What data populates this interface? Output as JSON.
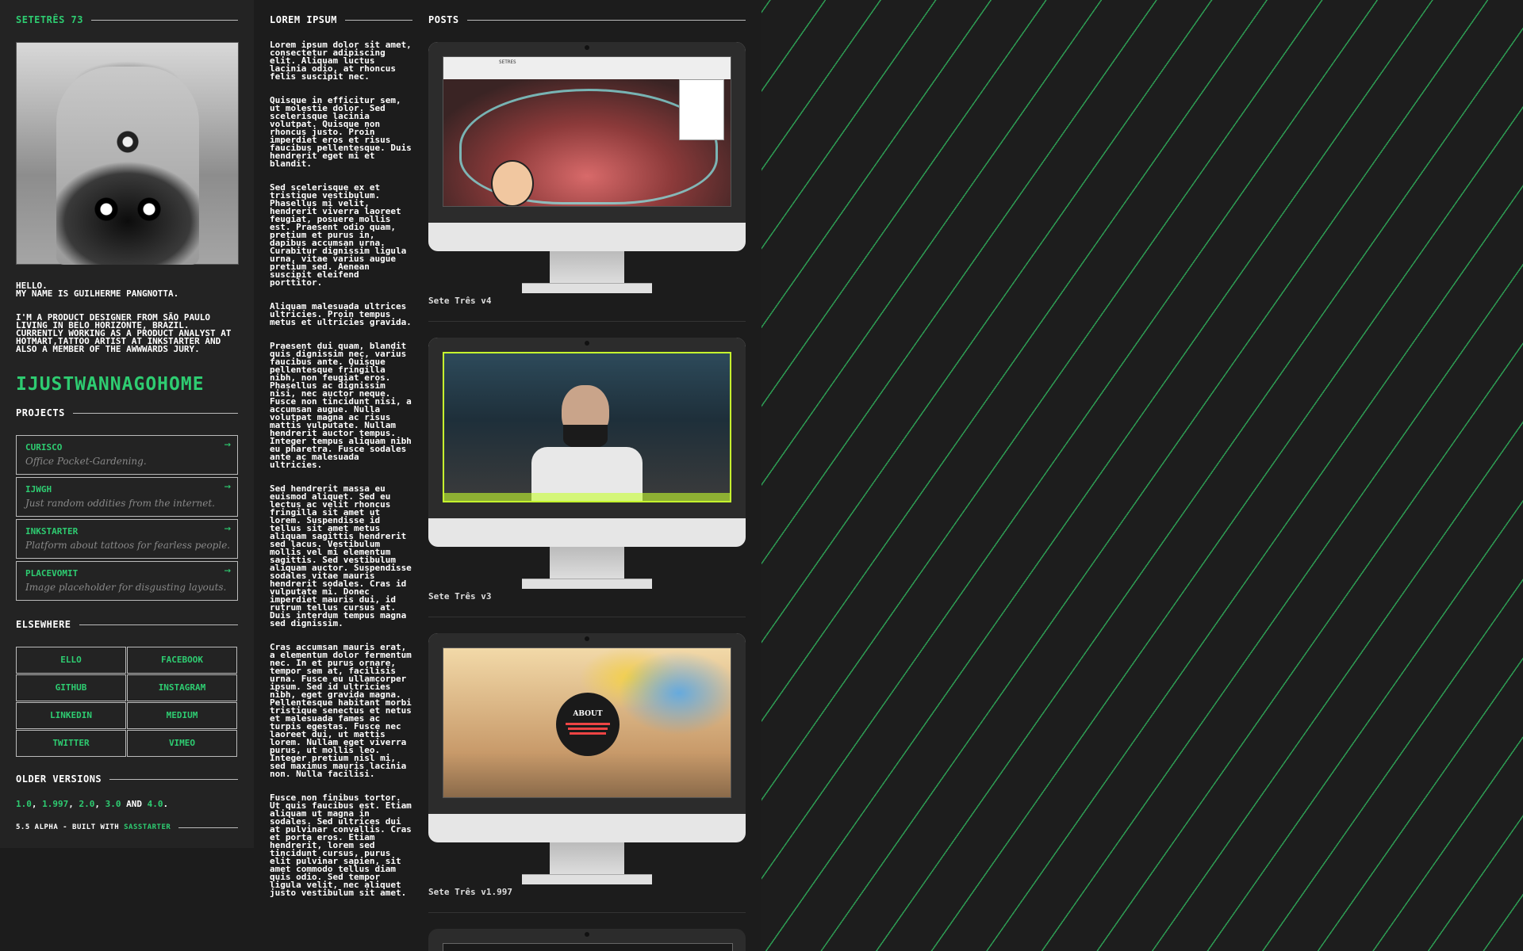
{
  "sidebar": {
    "site_title": "SETETRÊS 73",
    "hello": "HELLO.",
    "name_line": "MY NAME IS GUILHERME PANGNOTTA.",
    "bio": "I'M A PRODUCT DESIGNER FROM SÃO PAULO LIVING IN BELO HORIZONTE, BRAZIL. CURRENTLY WORKING AS A PRODUCT ANALYST AT HOTMART,TATTOO ARTIST AT INKSTARTER AND ALSO A MEMBER OF THE AWWWARDS JURY.",
    "handle": "IJUSTWANNAGOHOME",
    "projects_heading": "PROJECTS",
    "projects": [
      {
        "title": "CURISCO",
        "desc": "Office Pocket-Gardening.",
        "arrow": "→"
      },
      {
        "title": "IJWGH",
        "desc": "Just random oddities from the internet.",
        "arrow": "→"
      },
      {
        "title": "INKSTARTER",
        "desc": "Platform about tattoos for fearless people.",
        "arrow": "→"
      },
      {
        "title": "PLACEVOMIT",
        "desc": "Image placeholder for disgusting layouts.",
        "arrow": "→"
      }
    ],
    "elsewhere_heading": "ELSEWHERE",
    "social": [
      "ELLO",
      "FACEBOOK",
      "GITHUB",
      "INSTAGRAM",
      "LINKEDIN",
      "MEDIUM",
      "TWITTER",
      "VIMEO"
    ],
    "older_heading": "OLDER VERSIONS",
    "older": {
      "v1": "1.0",
      "sep1": ", ",
      "v2": "1.997",
      "sep2": ", ",
      "v3": "2.0",
      "sep3": ", ",
      "v4": "3.0",
      "and": " AND ",
      "v5": "4.0",
      "end": "."
    },
    "footer_text": "5.5 ALPHA - BUILT WITH ",
    "footer_link": "SASSTARTER"
  },
  "lorem": {
    "heading": "LOREM IPSUM",
    "paragraphs": [
      "Lorem ipsum dolor sit amet, consectetur adipiscing elit. Aliquam luctus lacinia odio, at rhoncus felis suscipit nec.",
      "Quisque in efficitur sem, ut molestie dolor. Sed scelerisque lacinia volutpat. Quisque non rhoncus justo. Proin imperdiet eros et risus faucibus pellentesque. Duis hendrerit eget mi et blandit.",
      "Sed scelerisque ex et tristique vestibulum. Phasellus mi velit, hendrerit viverra laoreet feugiat, posuere mollis est. Praesent odio quam, pretium et purus in, dapibus accumsan urna. Curabitur dignissim ligula urna, vitae varius augue pretium sed. Aenean suscipit eleifend porttitor.",
      "Aliquam malesuada ultrices ultricies. Proin tempus metus et ultricies gravida.",
      "Praesent dui quam, blandit quis dignissim nec, varius faucibus ante. Quisque pellentesque fringilla nibh, non feugiat eros. Phasellus ac dignissim nisi, nec auctor neque. Fusce non tincidunt nisi, a accumsan augue. Nulla volutpat magna ac risus mattis vulputate. Nullam hendrerit auctor tempus. Integer tempus aliquam nibh eu pharetra. Fusce sodales ante ac malesuada ultricies.",
      "Sed hendrerit massa eu euismod aliquet. Sed eu lectus ac velit rhoncus fringilla sit amet ut lorem. Suspendisse id tellus sit amet metus aliquam sagittis hendrerit sed lacus. Vestibulum mollis vel mi elementum sagittis. Sed vestibulum aliquam auctor. Suspendisse sodales vitae mauris hendrerit sodales. Cras id vulputate mi. Donec imperdiet mauris dui, id rutrum tellus cursus at. Duis interdum tempus magna sed dignissim.",
      "Cras accumsan mauris erat, a elementum dolor fermentum nec. In et purus ornare, tempor sem at, facilisis urna. Fusce eu ullamcorper ipsum. Sed id ultricies nibh, eget gravida magna. Pellentesque habitant morbi tristique senectus et netus et malesuada fames ac turpis egestas. Fusce nec laoreet dui, ut mattis lorem. Nullam eget viverra purus, ut mollis leo. Integer pretium nisl mi, sed maximus mauris lacinia non. Nulla facilisi.",
      "Fusce non finibus tortor. Ut quis faucibus est. Etiam aliquam ut magna in sodales. Sed ultrices dui at pulvinar convallis. Cras et porta eros. Etiam hendrerit, lorem sed tincidunt cursus, purus elit pulvinar sapien, sit amet commodo tellus diam quis odio. Sed tempor ligula velit, nec aliquet justo vestibulum sit amet."
    ]
  },
  "posts": {
    "heading": "POSTS",
    "items": [
      {
        "caption": "Sete Três v4",
        "screen_title": "SETRES"
      },
      {
        "caption": "Sete Três v3"
      },
      {
        "caption": "Sete Três v1.997",
        "badge_title": "ABOUT"
      }
    ]
  },
  "colors": {
    "accent": "#2ecc71",
    "background": "#1c1c1c",
    "sidebar": "#232323"
  }
}
